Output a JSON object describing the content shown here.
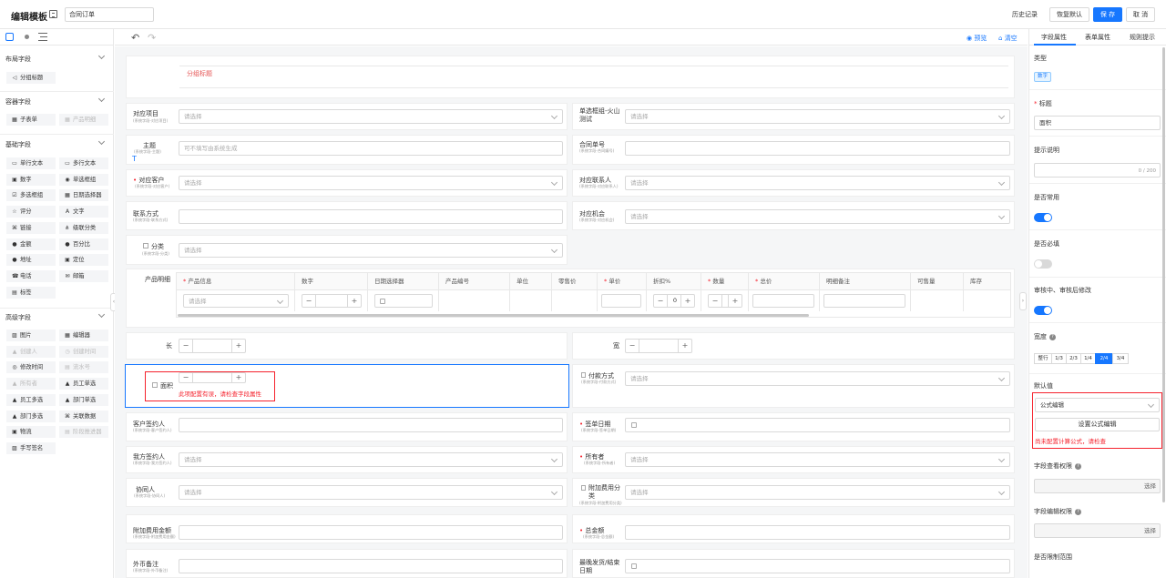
{
  "header": {
    "title": "编辑模板",
    "template_name": "合同订单",
    "history": "历史记录",
    "restore": "恢复默认",
    "save": "保 存",
    "cancel": "取 消"
  },
  "left_panel": {
    "sections": {
      "layout": {
        "title": "布局字段",
        "items": [
          "分组标题"
        ]
      },
      "container": {
        "title": "容器字段",
        "items": [
          "子表单",
          "产品明细"
        ]
      },
      "basic": {
        "title": "基础字段",
        "items": [
          "单行文本",
          "多行文本",
          "数字",
          "单选框组",
          "多选框组",
          "日期选择器",
          "评分",
          "文字",
          "链接",
          "级联分类",
          "金额",
          "百分比",
          "地址",
          "定位",
          "电话",
          "邮箱",
          "标签"
        ]
      },
      "advanced": {
        "title": "高级字段",
        "items": [
          "图片",
          "编辑器",
          "创建人",
          "创建时间",
          "修改时间",
          "流水号",
          "所有者",
          "员工单选",
          "员工多选",
          "部门单选",
          "部门多选",
          "关联数据",
          "物流",
          "阶段推进器",
          "手写签名"
        ]
      }
    }
  },
  "toolbar": {
    "preview": "预览",
    "clear": "清空"
  },
  "form": {
    "group_title": "分组标题",
    "fields": {
      "item": {
        "label": "对应项目",
        "sub": "(系统字段-对应项目)",
        "placeholder": "请选择"
      },
      "single_radio": {
        "label": "单选框组-火山测试",
        "placeholder": "请选择"
      },
      "subject": {
        "label": "主题",
        "sub": "(系统字段-主题)",
        "placeholder": "可不填写由系统生成"
      },
      "contract_no": {
        "label": "合同单号",
        "sub": "(系统字段-合同编号)"
      },
      "customer": {
        "label": "对应客户",
        "sub": "(系统字段-对应客户)",
        "placeholder": "请选择"
      },
      "contact": {
        "label": "对应联系人",
        "sub": "(系统字段-对应联系人)",
        "placeholder": "请选择"
      },
      "contact_way": {
        "label": "联系方式",
        "sub": "(系统字段-联系方式)"
      },
      "opportunity": {
        "label": "对应机会",
        "sub": "(系统字段-对应机会)",
        "placeholder": "请选择"
      },
      "category": {
        "label": "分类",
        "sub": "(系统字段-分类)",
        "placeholder": "请选择"
      },
      "product_detail": {
        "label": "产品明细"
      },
      "length": {
        "label": "长"
      },
      "width": {
        "label": "宽"
      },
      "area": {
        "label": "面积",
        "error": "此项配置有误，请检查字段属性"
      },
      "payment": {
        "label": "付款方式",
        "sub": "(系统字段-付款方式)",
        "placeholder": "请选择"
      },
      "customer_signer": {
        "label": "客户签约人",
        "sub": "(系统字段-客户签约人)"
      },
      "sign_date": {
        "label": "签单日期",
        "sub": "(系统字段-签单日期)"
      },
      "our_signer": {
        "label": "我方签约人",
        "sub": "(系统字段-我方签约人)",
        "placeholder": "请选择"
      },
      "owner": {
        "label": "所有者",
        "sub": "(系统字段-所有者)",
        "placeholder": "请选择"
      },
      "collaborator": {
        "label": "协同人",
        "sub": "(系统字段-协同人)",
        "placeholder": "请选择"
      },
      "extra_fee_cat": {
        "label": "附加费用分类",
        "sub": "(系统字段-附加费用分类)",
        "placeholder": "请选择"
      },
      "extra_fee_total": {
        "label": "附加费用金额",
        "sub": "(系统字段-附加费用金额)"
      },
      "total_amount": {
        "label": "总金额",
        "sub": "(系统字段-总金额)"
      },
      "fx_remark": {
        "label": "外币备注",
        "sub": "(系统字段-外币备注)"
      },
      "last_ship": {
        "label": "最晚发货/结束日期"
      }
    },
    "product_table": {
      "columns": [
        "产品信息",
        "数字",
        "日期选择器",
        "产品编号",
        "单位",
        "零售价",
        "单价",
        "折扣%",
        "数量",
        "总价",
        "明细备注",
        "可售量",
        "库存"
      ],
      "required": [
        "产品信息",
        "单价",
        "数量",
        "总价"
      ],
      "product_placeholder": "请选择",
      "discount_value": "0"
    }
  },
  "right_panel": {
    "tabs": [
      "字段属性",
      "表单属性",
      "规则提示"
    ],
    "type_label": "类型",
    "type_value": "数字",
    "title_label": "标题",
    "title_value": "面积",
    "hint_label": "提示说明",
    "hint_counter": "0 / 200",
    "common_label": "是否常用",
    "common_on": true,
    "required_label": "是否必填",
    "required_on": false,
    "audit_label": "审核中、审核后修改",
    "audit_on": true,
    "width_label": "宽度",
    "width_options": [
      "整行",
      "1/3",
      "2/3",
      "1/4",
      "2/4",
      "3/4"
    ],
    "width_selected": "2/4",
    "default_label": "默认值",
    "default_value": "公式编辑",
    "formula_button": "设置公式编辑",
    "formula_error": "尚未配置计算公式，请检查",
    "view_perm_label": "字段查看权限",
    "edit_perm_label": "字段编辑权限",
    "select": "选择",
    "range_label": "是否限制范围",
    "colors": {
      "accent": "#1677ff",
      "error": "#f5222d"
    }
  }
}
